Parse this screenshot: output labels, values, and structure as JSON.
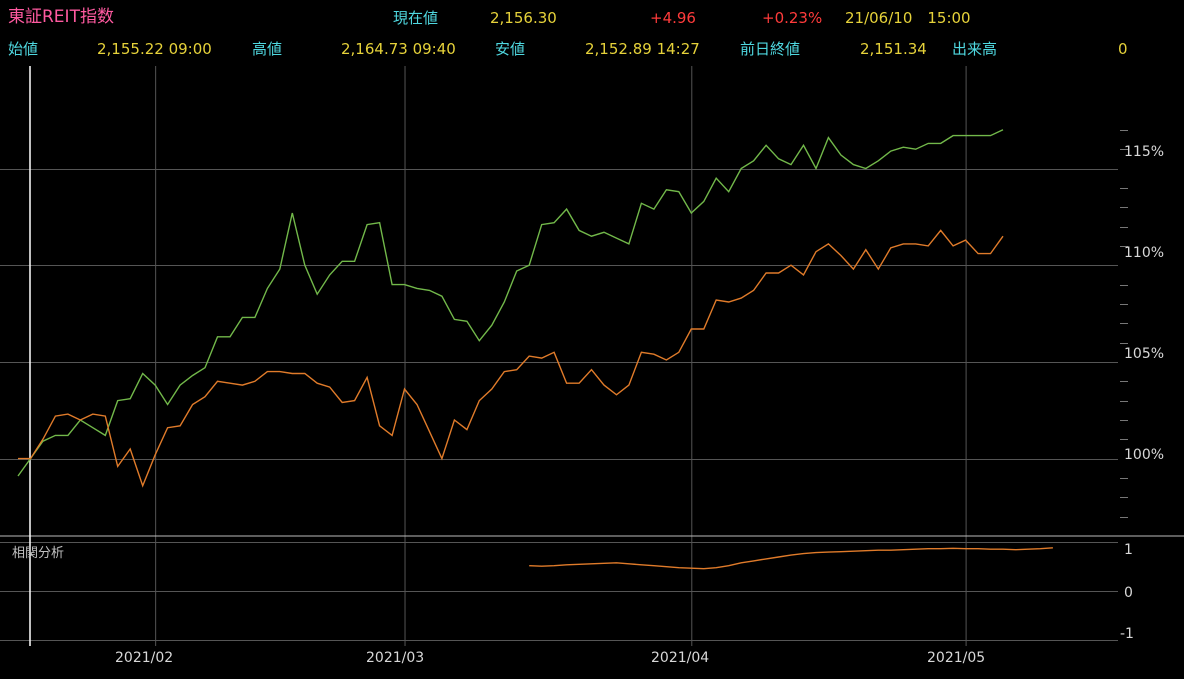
{
  "header": {
    "title": "東証REIT指数",
    "current_label": "現在値",
    "current_value": "2,156.30",
    "change": "+4.96",
    "change_pct": "+0.23%",
    "datetime": "21/06/10　15:00",
    "open_label": "始値",
    "open_value": "2,155.22 09:00",
    "high_label": "高値",
    "high_value": "2,164.73 09:40",
    "low_label": "安値",
    "low_value": "2,152.89 14:27",
    "prev_close_label": "前日終値",
    "prev_close_value": "2,151.34",
    "volume_label": "出来高",
    "volume_value": "0"
  },
  "sub_panel": {
    "label": "相関分析"
  },
  "colors": {
    "green_series": "#72b84a",
    "orange_series": "#e07b2a",
    "grid": "#555555",
    "cyan": "#4fd8e0",
    "yellow": "#e6d23a",
    "red": "#ff3b3b",
    "title": "#ff5aa0"
  },
  "chart_data": [
    {
      "type": "line",
      "x_tick_labels": [
        "2021/02",
        "2021/03",
        "2021/04",
        "2021/05"
      ],
      "x_tick_index": [
        11,
        31,
        54,
        76
      ],
      "y_tick_labels": [
        "115%",
        "110%",
        "105%",
        "100%"
      ],
      "y_ticks": [
        115,
        110,
        105,
        100
      ],
      "ylim": [
        96,
        120.3
      ],
      "grid": true,
      "series": [
        {
          "color": "green",
          "values": [
            99.1,
            100.0,
            100.9,
            101.2,
            101.2,
            102.0,
            101.6,
            101.2,
            103.0,
            103.1,
            104.4,
            103.8,
            102.8,
            103.8,
            104.3,
            104.7,
            106.3,
            106.3,
            107.3,
            107.3,
            108.8,
            109.8,
            112.7,
            110.0,
            108.5,
            109.5,
            110.2,
            110.2,
            112.1,
            112.2,
            109.0,
            109.0,
            108.8,
            108.7,
            108.4,
            107.2,
            107.1,
            106.1,
            106.9,
            108.1,
            109.7,
            110.0,
            112.1,
            112.2,
            112.9,
            111.8,
            111.5,
            111.7,
            111.4,
            111.1,
            113.2,
            112.9,
            113.9,
            113.8,
            112.7,
            113.3,
            114.5,
            113.8,
            115.0,
            115.4,
            116.2,
            115.5,
            115.2,
            116.2,
            115.0,
            116.6,
            115.7,
            115.2,
            115.0,
            115.4,
            115.9,
            116.1,
            116.0,
            116.3,
            116.3,
            116.7,
            116.7,
            116.7,
            116.7,
            117.0
          ]
        },
        {
          "color": "orange",
          "values": [
            100.0,
            100.0,
            101.0,
            102.2,
            102.3,
            102.0,
            102.3,
            102.2,
            99.6,
            100.5,
            98.6,
            100.2,
            101.6,
            101.7,
            102.8,
            103.2,
            104.0,
            103.9,
            103.8,
            104.0,
            104.5,
            104.5,
            104.4,
            104.4,
            103.9,
            103.7,
            102.9,
            103.0,
            104.2,
            101.7,
            101.2,
            103.6,
            102.8,
            101.4,
            100.0,
            102.0,
            101.5,
            103.0,
            103.6,
            104.5,
            104.6,
            105.3,
            105.2,
            105.5,
            103.9,
            103.9,
            104.6,
            103.8,
            103.3,
            103.8,
            105.5,
            105.4,
            105.1,
            105.5,
            106.7,
            106.7,
            108.2,
            108.1,
            108.3,
            108.7,
            109.6,
            109.6,
            110.0,
            109.5,
            110.7,
            111.1,
            110.5,
            109.8,
            110.8,
            109.8,
            110.9,
            111.1,
            111.1,
            111.0,
            111.8,
            111.0,
            111.3,
            110.6,
            110.6,
            111.5
          ]
        }
      ]
    },
    {
      "type": "line",
      "title": "相関分析",
      "y_tick_labels": [
        "1",
        "0",
        "-1"
      ],
      "y_ticks": [
        1,
        0,
        -1
      ],
      "ylim": [
        -1.05,
        1.05
      ],
      "grid": true,
      "series": [
        {
          "color": "orange",
          "start_index": 41,
          "values": [
            0.52,
            0.51,
            0.52,
            0.54,
            0.55,
            0.56,
            0.57,
            0.58,
            0.56,
            0.54,
            0.52,
            0.5,
            0.48,
            0.47,
            0.46,
            0.48,
            0.52,
            0.58,
            0.62,
            0.66,
            0.7,
            0.74,
            0.77,
            0.79,
            0.8,
            0.81,
            0.82,
            0.83,
            0.84,
            0.84,
            0.85,
            0.86,
            0.87,
            0.87,
            0.88,
            0.87,
            0.87,
            0.86,
            0.86,
            0.85,
            0.86,
            0.87,
            0.89
          ]
        }
      ]
    }
  ]
}
